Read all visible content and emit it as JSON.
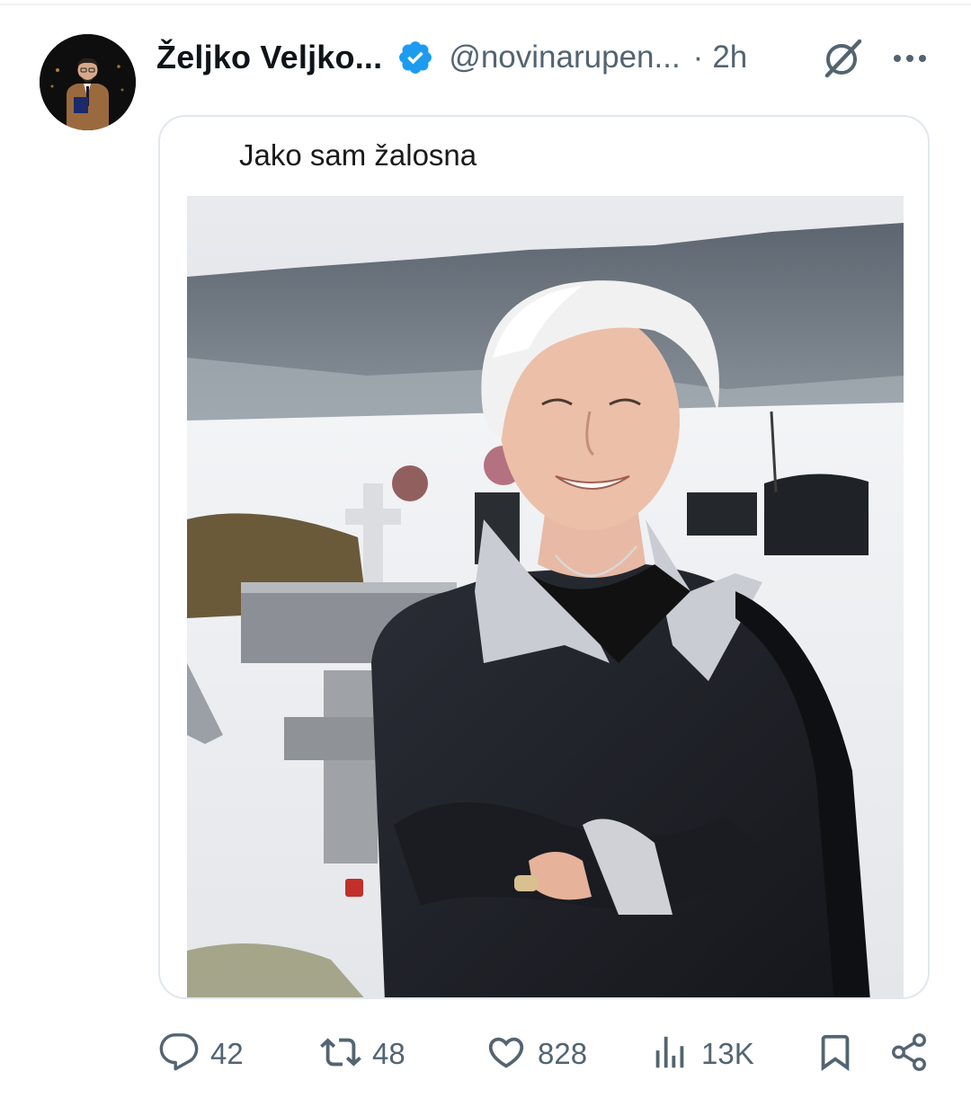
{
  "tweet": {
    "author": {
      "display_name": "Željko Veljko...",
      "handle": "@novinarupen...",
      "verified": true,
      "avatar": "avatar-photo"
    },
    "separator": "·",
    "time": "2h",
    "icons": {
      "grok": "grok-icon",
      "more": "more-icon"
    },
    "media": {
      "caption": "Jako sam žalosna",
      "photo": "woman-in-snowy-cemetery-photo"
    },
    "actions": [
      {
        "name": "reply",
        "icon": "reply-icon",
        "count": "42"
      },
      {
        "name": "repost",
        "icon": "repost-icon",
        "count": "48"
      },
      {
        "name": "like",
        "icon": "heart-icon",
        "count": "828"
      },
      {
        "name": "views",
        "icon": "views-icon",
        "count": "13K"
      },
      {
        "name": "bookmark",
        "icon": "bookmark-icon",
        "count": ""
      },
      {
        "name": "share",
        "icon": "share-icon",
        "count": ""
      }
    ]
  },
  "colors": {
    "text_primary": "#0f1419",
    "text_secondary": "#536471",
    "verified": "#1d9bf0",
    "border": "#e1e8ed"
  }
}
